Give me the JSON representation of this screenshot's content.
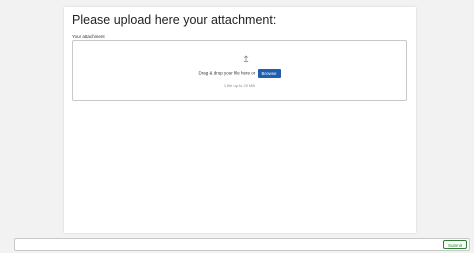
{
  "form": {
    "title": "Please upload here your attachment:",
    "field_label": "Your attachment",
    "dropzone": {
      "icon": "upload-arrow-icon",
      "instruction": "Drag & drop your file here or",
      "browse_label": "Browse",
      "limit_text": "1 file up to 20 MB"
    }
  },
  "footer": {
    "submit_label": "Submit"
  },
  "colors": {
    "browse_button": "#1f5fb0",
    "submit_accent": "#2e7d32",
    "background": "#f2f2f2"
  }
}
